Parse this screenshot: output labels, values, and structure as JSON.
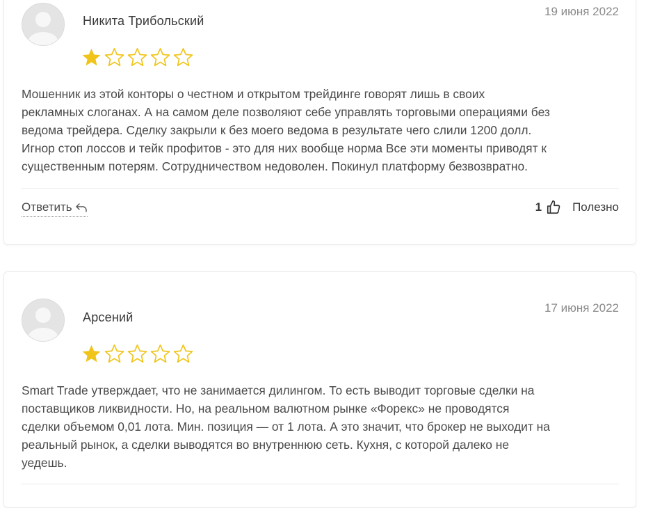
{
  "reviews": [
    {
      "author": "Никита Трибольский",
      "date": "19 июня 2022",
      "rating": 1,
      "max_rating": 5,
      "text": "Мошенник из этой конторы о честном и открытом трейдинге говорят лишь в своих\nрекламных слоганах. А на самом деле позволяют себе управлять торговыми операциями без\nведома трейдера. Сделку закрыли к без моего ведома в результате чего слили 1200 долл.\nИгнор стоп лоссов и тейк профитов - это для них вообще норма Все эти моменты приводят к\nсущественным потерям. Сотрудничеством недоволен. Покинул платформу безвозвратно.",
      "reply_label": "Ответить",
      "useful_count": "1",
      "useful_label": "Полезно"
    },
    {
      "author": "Арсений",
      "date": "17 июня 2022",
      "rating": 1,
      "max_rating": 5,
      "text": "Smart Trade утверждает, что не занимается дилингом. То есть выводит торговые сделки на\nпоставщиков ликвидности. Но, на реальном валютном рынке «Форекс» не проводятся\nсделки объемом 0,01 лота. Мин. позиция — от 1 лота. А это значит, что брокер не выходит на\nреальный рынок, а сделки выводятся во внутреннюю сеть. Кухня, с которой далеко не\nуедешь."
    }
  ],
  "icons": {
    "avatar": "user-avatar-placeholder",
    "star_filled": "star-filled-icon",
    "star_empty": "star-outline-icon",
    "reply": "reply-arrow-icon",
    "thumb": "thumbs-up-icon"
  },
  "colors": {
    "star": "#f0c419",
    "avatar_bg": "#e6e6e6",
    "avatar_fg": "#f7f7f7",
    "date": "#8a8a8a"
  }
}
